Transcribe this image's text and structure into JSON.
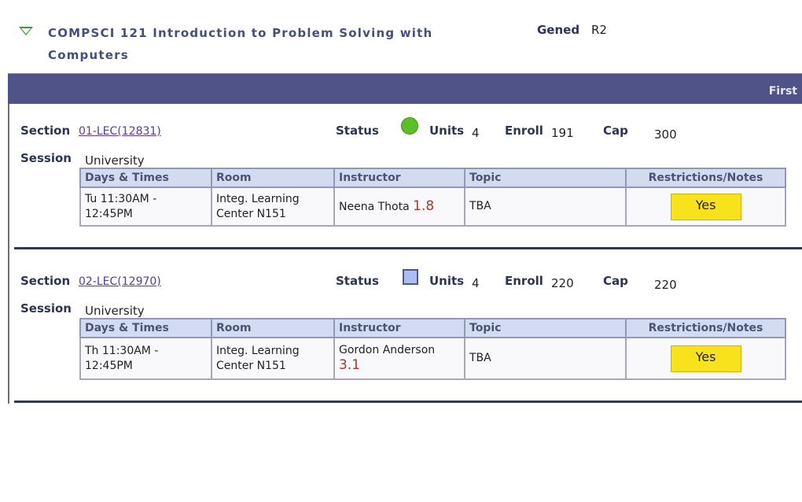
{
  "course": {
    "title": "COMPSCI  121 Introduction to Problem Solving with Computers",
    "gened_label": "Gened",
    "gened_value": "R2"
  },
  "band": {
    "right_label": "First"
  },
  "labels": {
    "section": "Section",
    "session": "Session",
    "status": "Status",
    "units": "Units",
    "enroll": "Enroll",
    "cap": "Cap"
  },
  "table_headers": [
    "Days & Times",
    "Room",
    "Instructor",
    "Topic",
    "Restrictions/Notes"
  ],
  "sections": [
    {
      "link": "01-LEC(12831)",
      "session": "University",
      "status": "open",
      "status_color": "#5cbf28",
      "units": "4",
      "enroll": "191",
      "cap": "300",
      "row": {
        "days_times": "Tu 11:30AM - 12:45PM",
        "room": "Integ. Learning Center N151",
        "instructor": "Neena Thota",
        "rating": "1.8",
        "topic": "TBA",
        "notes_button": "Yes"
      }
    },
    {
      "link": "02-LEC(12970)",
      "session": "University",
      "status": "closed",
      "status_color": "#a9bff2",
      "units": "4",
      "enroll": "220",
      "cap": "220",
      "row": {
        "days_times": "Th 11:30AM - 12:45PM",
        "room": "Integ. Learning Center N151",
        "instructor": "Gordon Anderson",
        "rating": "3.1",
        "topic": "TBA",
        "notes_button": "Yes"
      }
    }
  ]
}
